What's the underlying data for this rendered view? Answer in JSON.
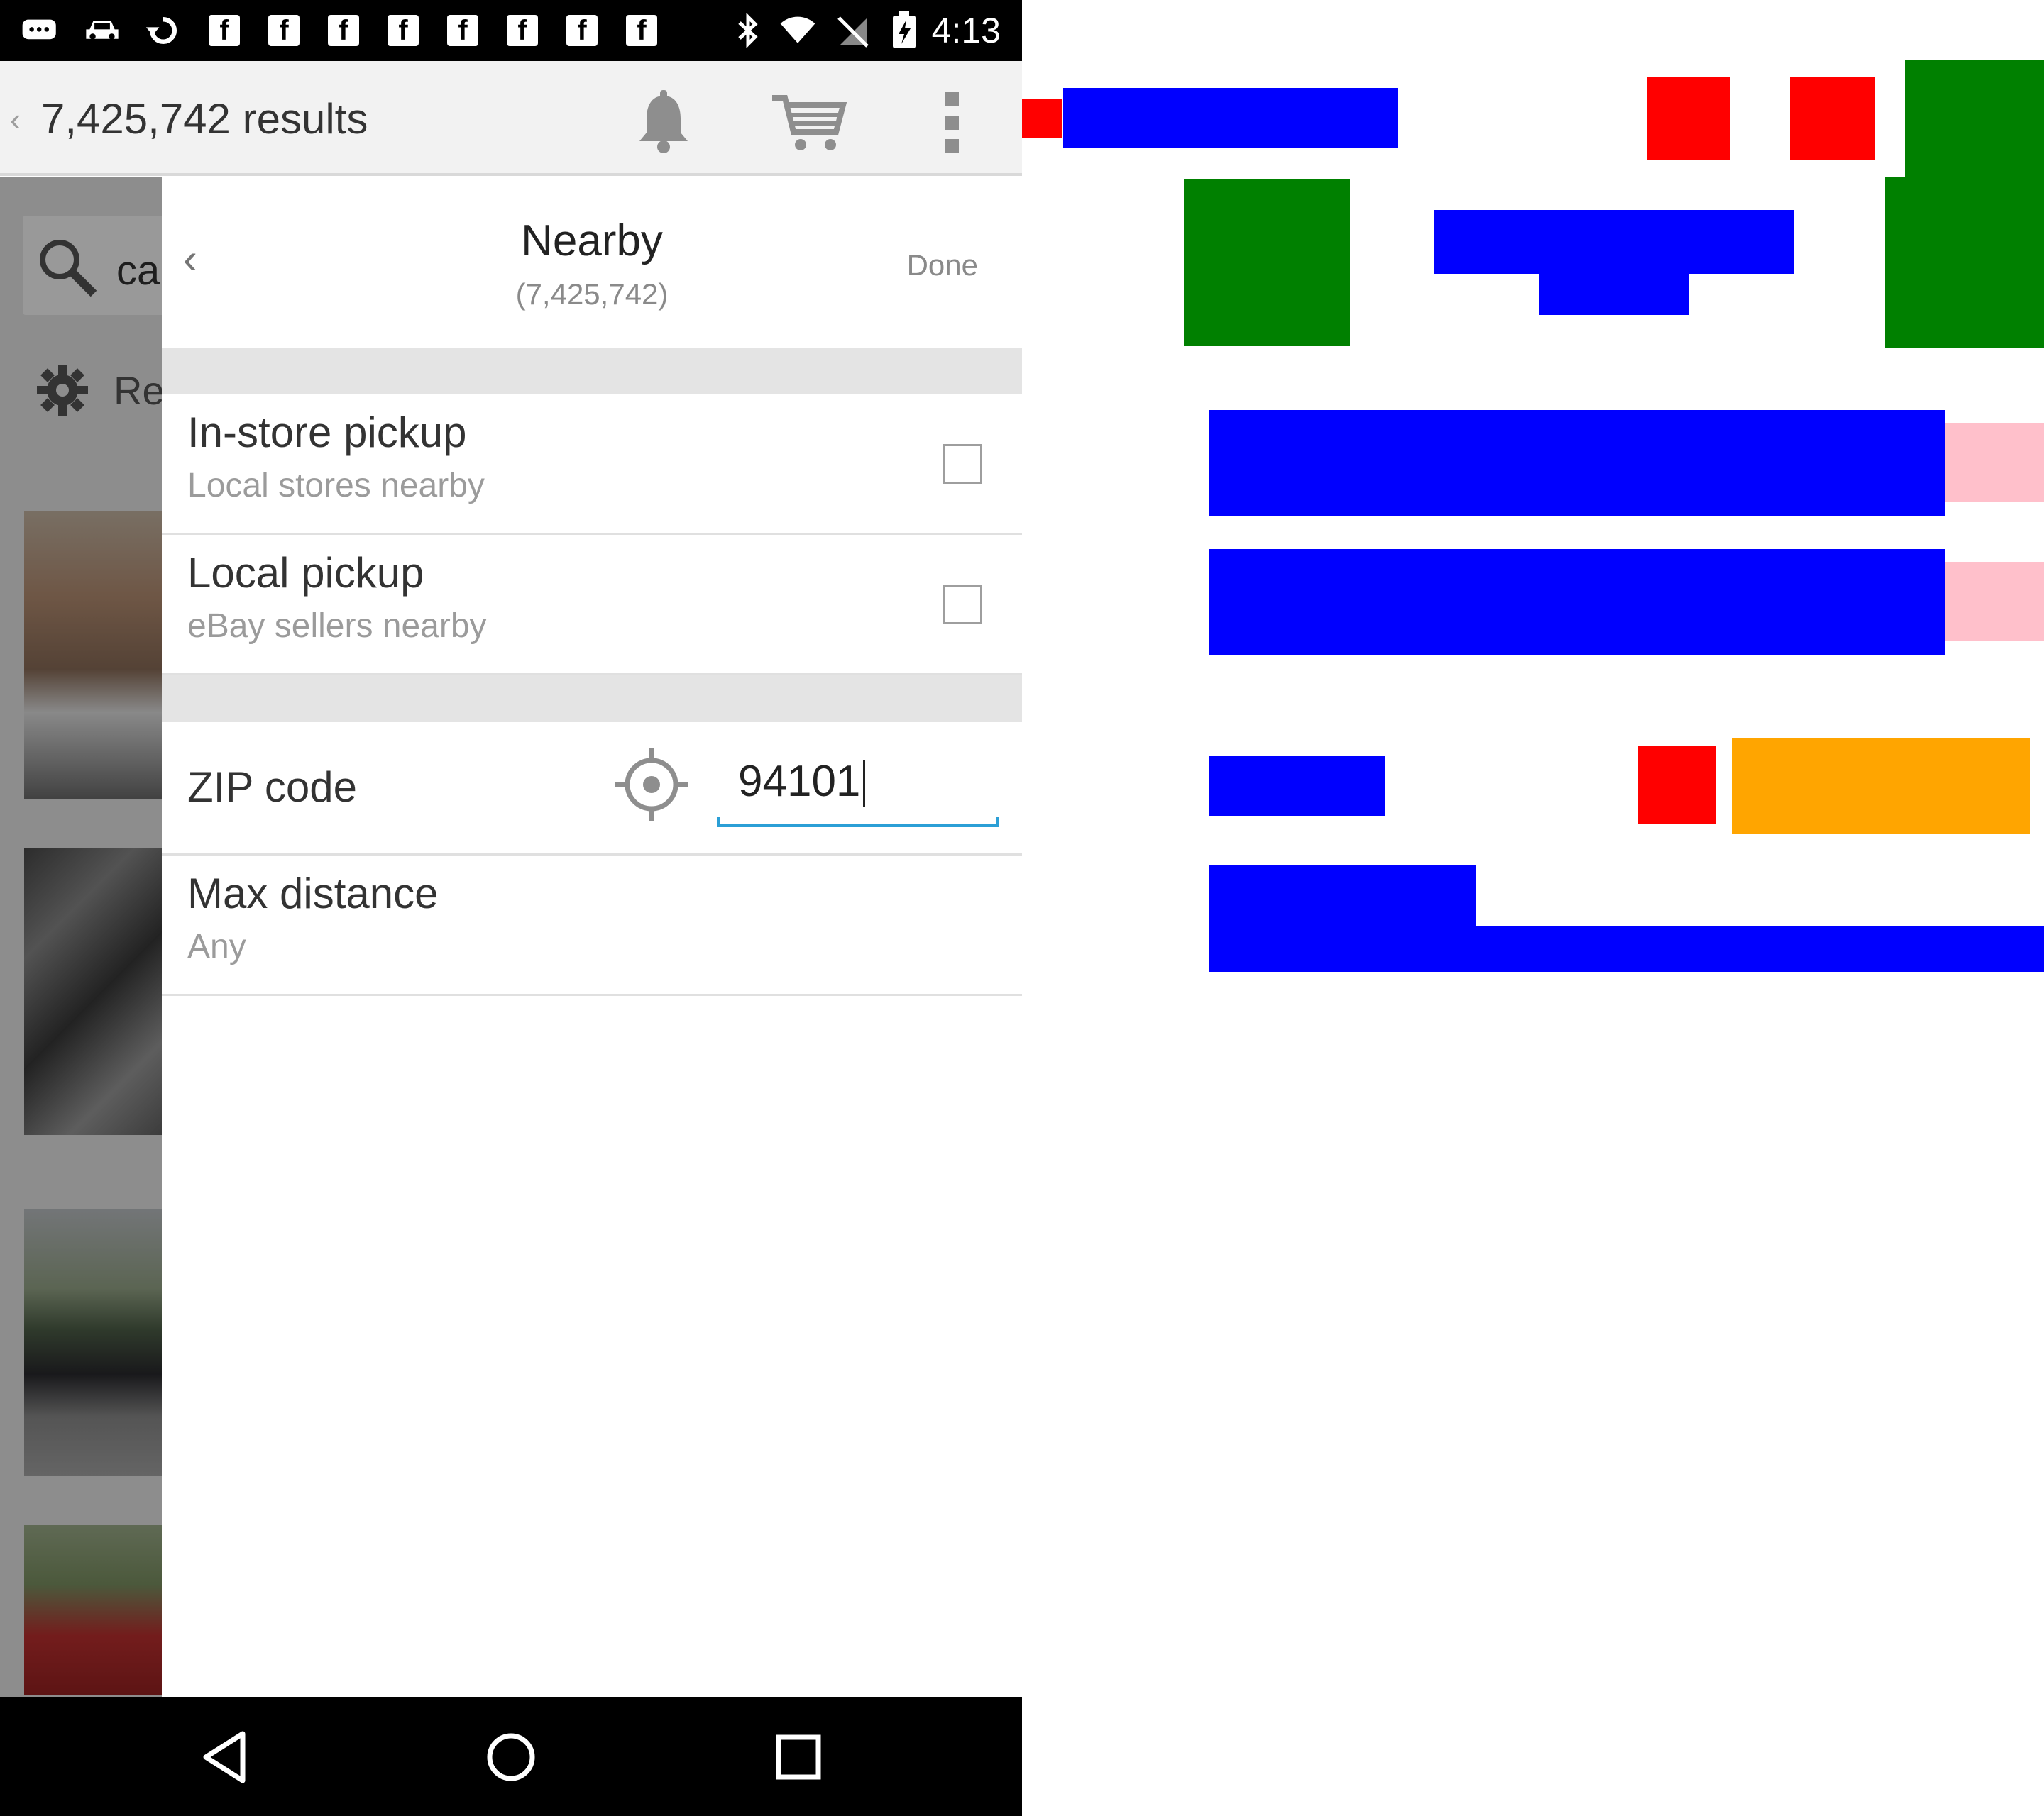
{
  "status_bar": {
    "time": "4:13",
    "notification_icons": [
      "chat-icon",
      "car-icon",
      "refresh-icon",
      "facebook-icon",
      "facebook-icon",
      "facebook-icon",
      "facebook-icon",
      "facebook-icon",
      "facebook-icon",
      "facebook-icon",
      "facebook-icon"
    ],
    "system_icons": [
      "bluetooth-icon",
      "wifi-icon",
      "no-sim-icon",
      "battery-charging-icon"
    ],
    "fb_letter": "f"
  },
  "action_bar": {
    "back_glyph": "‹",
    "results_text": "7,425,742 results",
    "actions": [
      "bell-icon",
      "cart-icon",
      "overflow-menu-icon"
    ]
  },
  "background": {
    "search_text": "ca",
    "refine_text": "Re"
  },
  "panel": {
    "back_glyph": "‹",
    "title": "Nearby",
    "count": "(7,425,742)",
    "done_label": "Done",
    "in_store": {
      "title": "In-store pickup",
      "subtitle": "Local stores nearby",
      "checked": false
    },
    "local_pickup": {
      "title": "Local pickup",
      "subtitle": "eBay sellers nearby",
      "checked": false
    },
    "zip": {
      "label": "ZIP code",
      "value": "94101"
    },
    "max_distance": {
      "title": "Max distance",
      "value": "Any"
    }
  },
  "nav_bar": {
    "buttons": [
      "back-icon",
      "home-icon",
      "recents-icon"
    ]
  },
  "colors": {
    "accent": "#2b9fd6",
    "blue": "#0000ff",
    "red": "#ff0000",
    "green": "#008000",
    "pink": "#ffc0cb",
    "orange": "#ffa500"
  }
}
